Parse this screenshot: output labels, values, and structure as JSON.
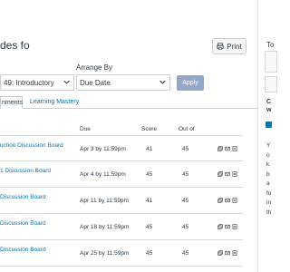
{
  "header": {
    "title": "des fo",
    "print_label": "Print"
  },
  "filters": {
    "course_label": "",
    "course_value": "49: Introductory",
    "arrange_label": "Arrange By",
    "arrange_value": "Due Date",
    "apply_label": "Apply"
  },
  "tabs": [
    {
      "label": "nments"
    },
    {
      "label": "Learning Mastery"
    }
  ],
  "table": {
    "headers": {
      "due": "Due",
      "score": "Score",
      "out_of": "Out of"
    },
    "rows": [
      {
        "name": "uction Discussion Board",
        "due": "Apr 3 by 11:59pm",
        "score": "41",
        "out_of": "45"
      },
      {
        "name": "1 Discussion Board",
        "due": "Apr 4 by 11:59pm",
        "score": "45",
        "out_of": "45"
      },
      {
        "name": "Discussion Board",
        "due": "Apr 11 by 11:59pm",
        "score": "41",
        "out_of": "45"
      },
      {
        "name": "Discussion Board",
        "due": "Apr 18 by 11:59pm",
        "score": "45",
        "out_of": "45"
      },
      {
        "name": "Discussion Board",
        "due": "Apr 25 by 11:59pm",
        "score": "45",
        "out_of": "45"
      }
    ]
  },
  "right_panel": {
    "to": "To",
    "c": "C",
    "w": "w",
    "lines": [
      "Y",
      "o",
      "k",
      "b",
      "a",
      "fo",
      "in",
      "th"
    ]
  },
  "colors": {
    "link": "#0374b5",
    "apply_bg": "#95a7c9",
    "text": "#2d3b45"
  }
}
